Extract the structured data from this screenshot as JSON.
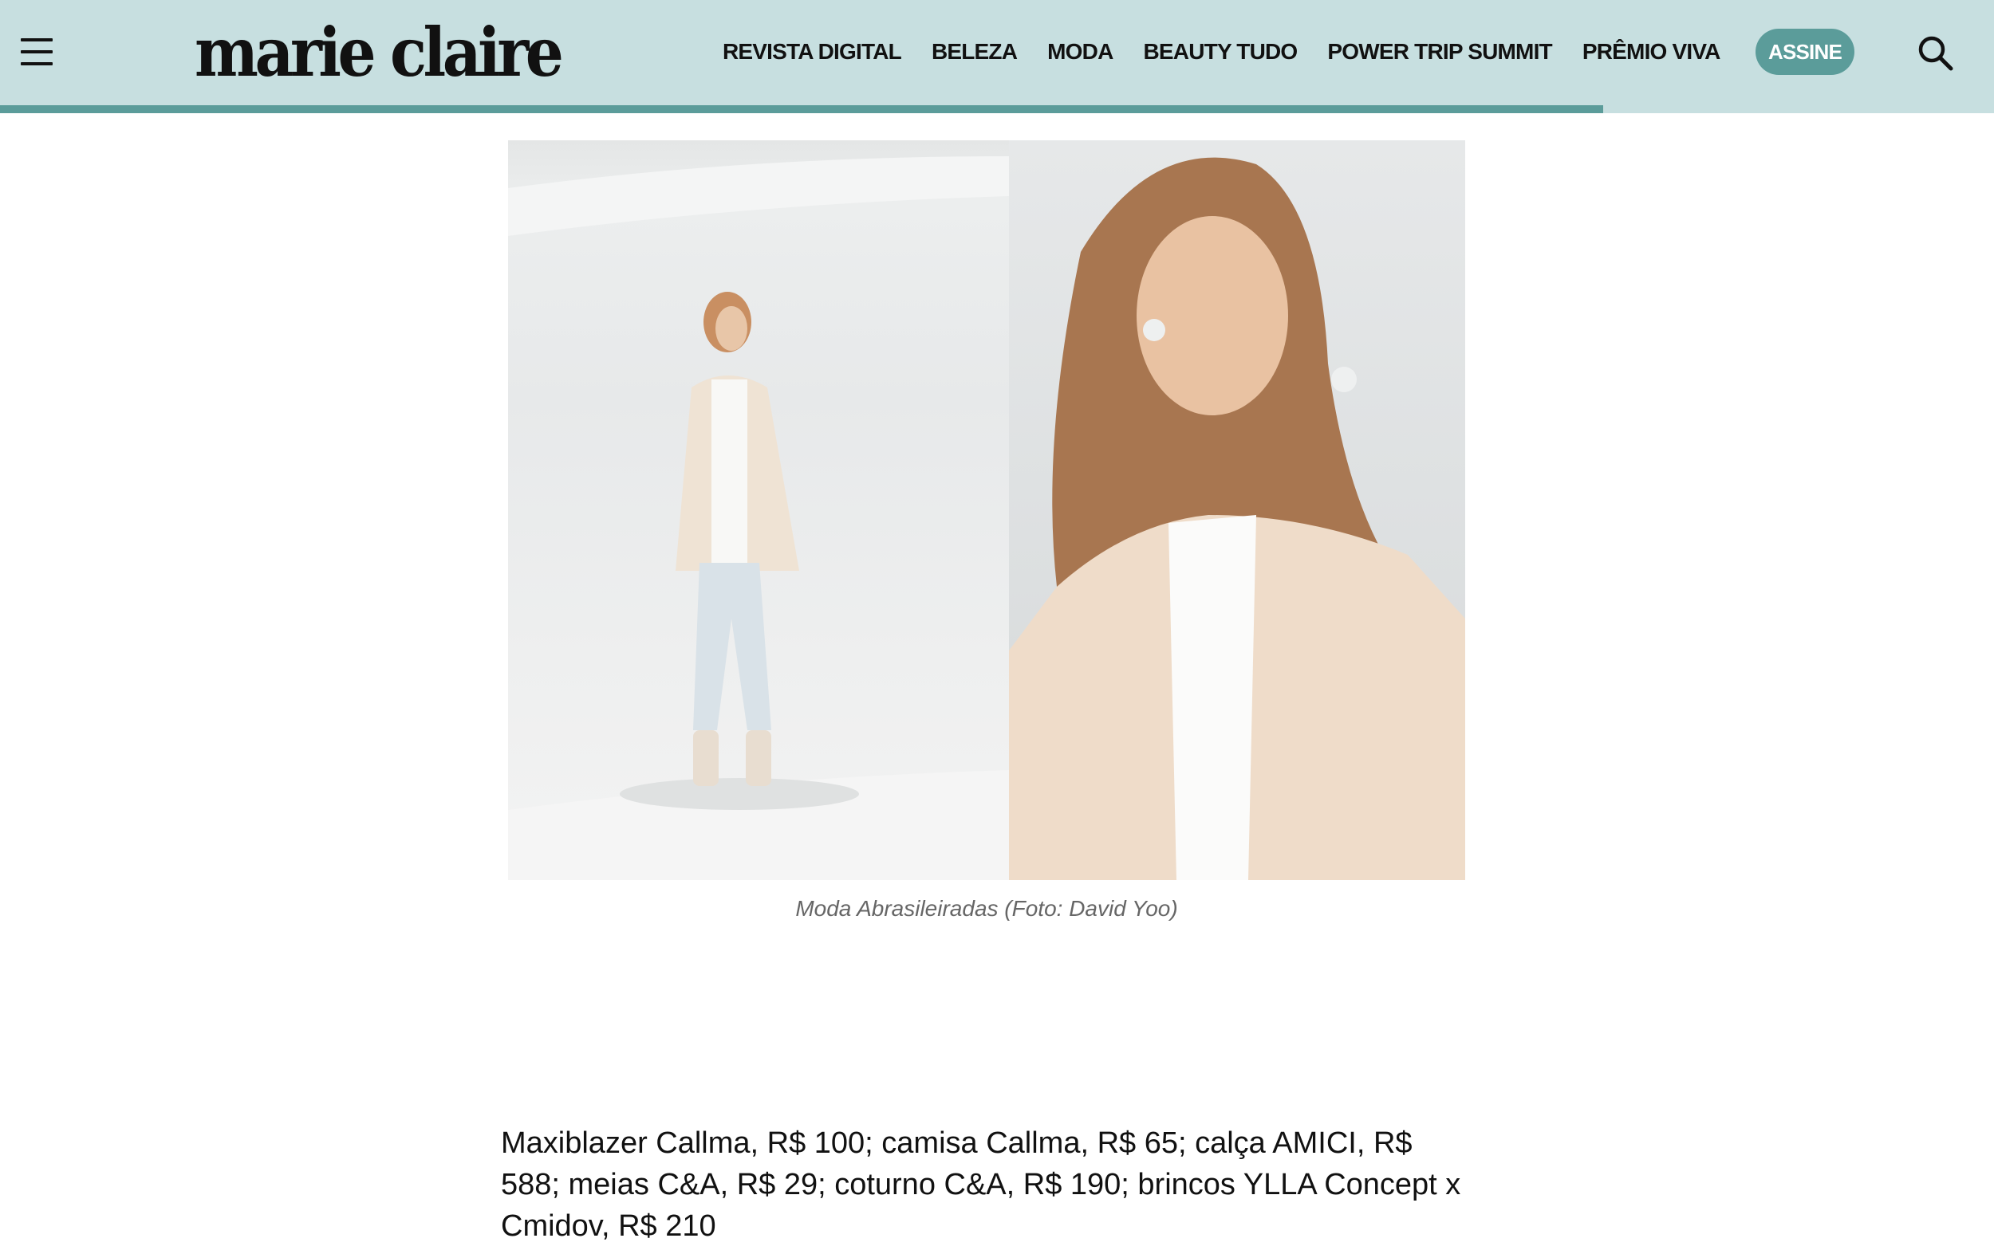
{
  "header": {
    "logo": "marie claire",
    "nav": [
      "REVISTA DIGITAL",
      "BELEZA",
      "MODA",
      "BEAUTY TUDO",
      "POWER TRIP SUMMIT",
      "PRÊMIO VIVA"
    ],
    "subscribe_label": "ASSINE",
    "reading_progress_percent": 80.4
  },
  "figure": {
    "caption": "Moda Abrasileiradas (Foto: David Yoo)"
  },
  "article": {
    "paragraph": "Maxiblazer Callma, R$ 100; camisa Callma, R$ 65; calça AMICI, R$ 588; meias C&A, R$ 29; coturno C&A, R$ 190; brincos YLLA Concept x Cmidov, R$ 210"
  },
  "colors": {
    "header_bg": "#c7dfe0",
    "accent": "#5b9c9a"
  },
  "icons": [
    "hamburger-menu-icon",
    "search-icon"
  ]
}
